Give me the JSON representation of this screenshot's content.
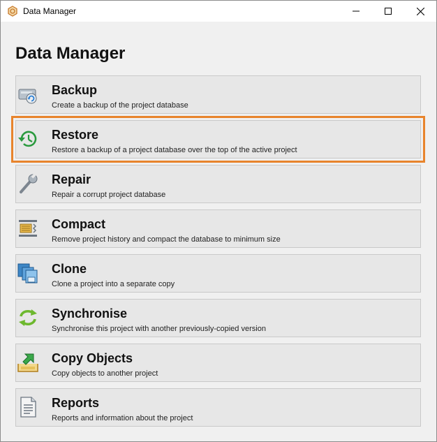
{
  "window": {
    "title": "Data Manager",
    "heading": "Data Manager"
  },
  "colors": {
    "highlight": "#e8842c",
    "item_bg": "#e7e7e7",
    "item_border": "#c9c9c9"
  },
  "items": [
    {
      "label": "Backup",
      "description": "Create a backup of the project database",
      "icon": "backup-icon"
    },
    {
      "label": "Restore",
      "description": "Restore a backup of a project database over the top of the active project",
      "icon": "restore-icon",
      "highlighted": true
    },
    {
      "label": "Repair",
      "description": "Repair a corrupt project database",
      "icon": "repair-icon"
    },
    {
      "label": "Compact",
      "description": "Remove project history and compact the database to minimum size",
      "icon": "compact-icon"
    },
    {
      "label": "Clone",
      "description": "Clone a project into a separate copy",
      "icon": "clone-icon"
    },
    {
      "label": "Synchronise",
      "description": "Synchronise this project with another previously-copied version",
      "icon": "synchronise-icon"
    },
    {
      "label": "Copy Objects",
      "description": "Copy objects to another project",
      "icon": "copy-objects-icon"
    },
    {
      "label": "Reports",
      "description": "Reports and information about the project",
      "icon": "reports-icon"
    }
  ]
}
